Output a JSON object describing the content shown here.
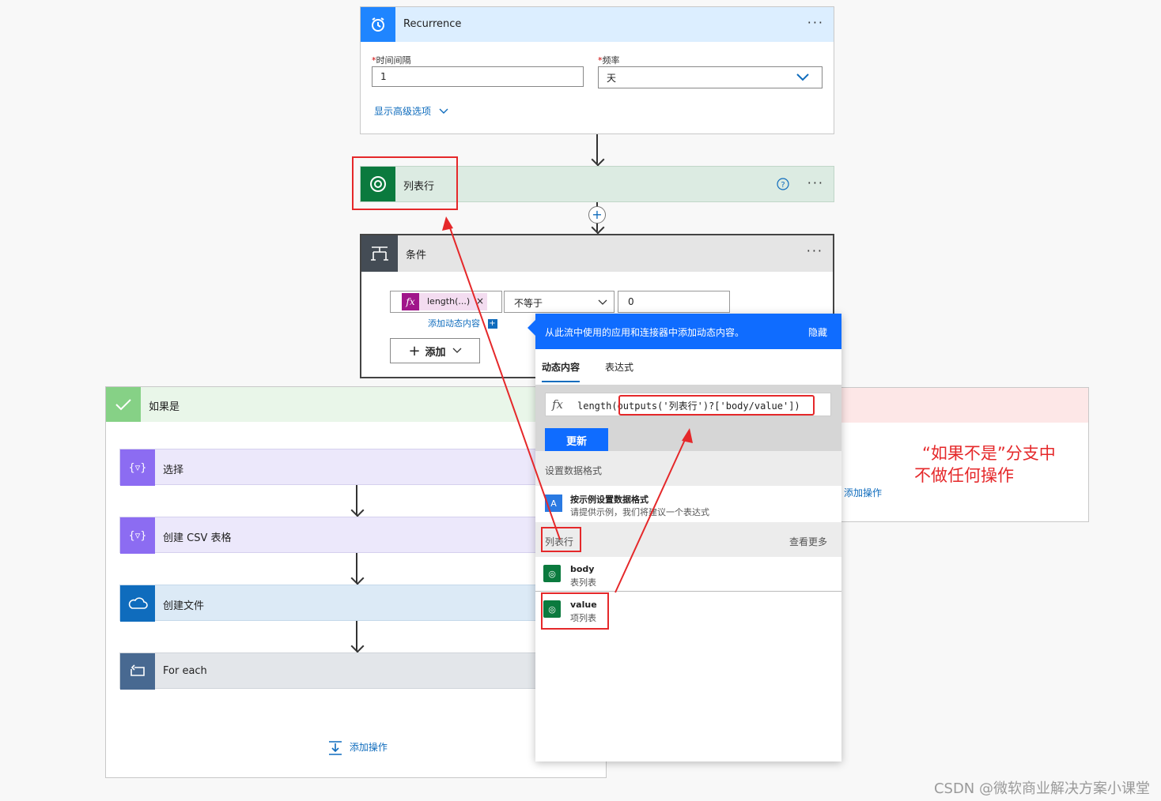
{
  "recurrence": {
    "title": "Recurrence",
    "interval_label": "时间间隔",
    "interval_value": "1",
    "frequency_label": "频率",
    "frequency_value": "天",
    "advanced_link": "显示高级选项"
  },
  "list_rows": {
    "title": "列表行"
  },
  "condition": {
    "title": "条件",
    "token_label": "length(...)",
    "token_remove": "×",
    "operator": "不等于",
    "value": "0",
    "add_dynamic_link": "添加动态内容",
    "add_button": "添加"
  },
  "if_yes": {
    "title": "如果是",
    "actions": [
      "选择",
      "创建 CSV 表格",
      "创建文件",
      "For each"
    ],
    "add_action": "添加操作"
  },
  "if_no": {
    "add_action": "添加操作",
    "annotation_line1": "“如果不是”分支中",
    "annotation_line2": "不做任何操作"
  },
  "dynamic_panel": {
    "header_text": "从此流中使用的应用和连接器中添加动态内容。",
    "hide_label": "隐藏",
    "tab_dynamic": "动态内容",
    "tab_expression": "表达式",
    "fx": "fx",
    "expression_prefix": "length(",
    "expression_highlight": "outputs('列表行')?['body/value']",
    "expression_suffix": ")",
    "update_button": "更新",
    "section_format": "设置数据格式",
    "format_item_title": "按示例设置数据格式",
    "format_item_desc": "请提供示例，我们将建议一个表达式",
    "section_list_rows": "列表行",
    "see_more": "查看更多",
    "items": [
      {
        "title": "body",
        "subtitle": "表列表"
      },
      {
        "title": "value",
        "subtitle": "项列表"
      }
    ]
  },
  "watermark": "CSDN @微软商业解决方案小课堂",
  "colors": {
    "recurrence_header": "#dceeff",
    "recurrence_icon": "#1f85ff",
    "dataverse_header": "#dcebe2",
    "dataverse_icon": "#0b7a3e",
    "condition_header": "#e5e5e5",
    "condition_icon": "#444c55",
    "yes_header": "#e9f6e9",
    "yes_icon": "#86d186",
    "no_header": "#fde7e7",
    "select_header": "#ece8fb",
    "select_icon": "#8c6cf2",
    "file_header": "#dceaf6",
    "file_icon": "#0f6cbd",
    "foreach_header": "#e3e6ea",
    "foreach_icon": "#486991",
    "panel_header": "#0f6cff",
    "annotation_red": "#e5282a"
  }
}
